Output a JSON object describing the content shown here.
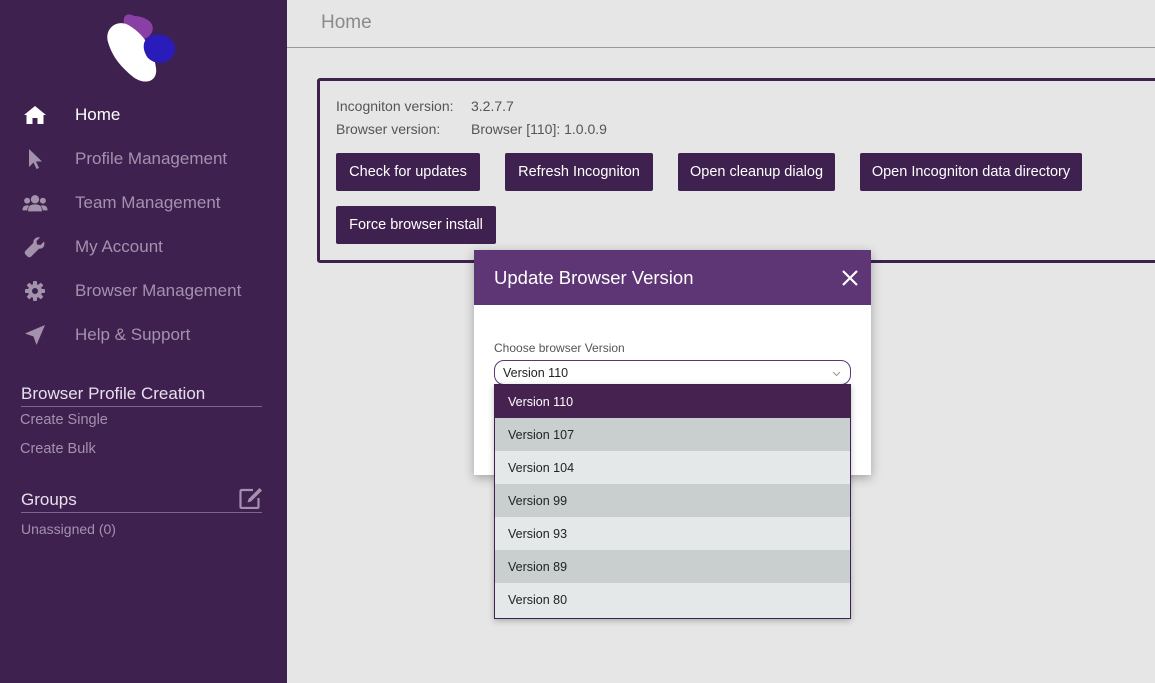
{
  "sidebar": {
    "nav": [
      {
        "label": "Home",
        "icon": "home-icon",
        "active": true
      },
      {
        "label": "Profile Management",
        "icon": "cursor-icon"
      },
      {
        "label": "Team Management",
        "icon": "users-icon"
      },
      {
        "label": "My Account",
        "icon": "wrench-icon"
      },
      {
        "label": "Browser Management",
        "icon": "gear-icon"
      },
      {
        "label": "Help & Support",
        "icon": "paper-plane-icon"
      }
    ],
    "profile_creation": {
      "title": "Browser Profile Creation",
      "links": [
        "Create Single",
        "Create Bulk"
      ]
    },
    "groups": {
      "title": "Groups",
      "items": [
        "Unassigned (0)"
      ]
    }
  },
  "main": {
    "title": "Home",
    "info": {
      "incogniton_label": "Incogniton version:",
      "incogniton_value": "3.2.7.7",
      "browser_label": "Browser version:",
      "browser_value": "Browser [110]: 1.0.0.9"
    },
    "buttons": {
      "check_updates": "Check for updates",
      "refresh": "Refresh Incogniton",
      "cleanup": "Open cleanup dialog",
      "data_dir": "Open Incogniton data directory",
      "force_install": "Force browser install"
    }
  },
  "modal": {
    "title": "Update Browser Version",
    "field_label": "Choose browser Version",
    "selected": "Version 110",
    "options": [
      "Version 110",
      "Version 107",
      "Version 104",
      "Version 99",
      "Version 93",
      "Version 89",
      "Version 80"
    ]
  },
  "colors": {
    "sidebar_bg": "#3f2150",
    "accent": "#5e3575",
    "selected_option": "#45224f"
  }
}
